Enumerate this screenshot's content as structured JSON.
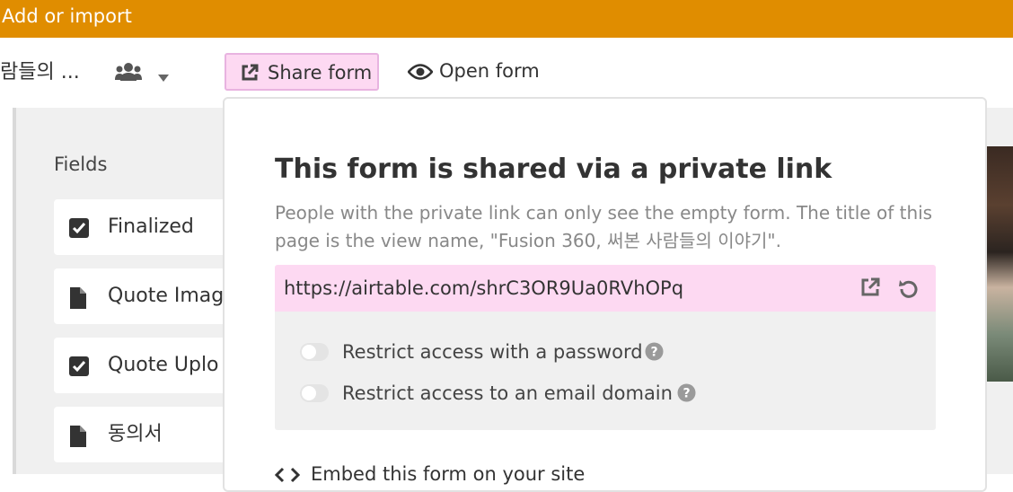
{
  "topbar": {
    "label": "Add or import"
  },
  "toolbar": {
    "view_name": "람들의 ...",
    "share_label": "Share form",
    "open_label": "Open form"
  },
  "fields_panel": {
    "heading": "Fields",
    "items": [
      {
        "label": "Finalized",
        "icon": "checkbox-icon"
      },
      {
        "label": "Quote Imag",
        "icon": "file-icon"
      },
      {
        "label": "Quote Uplo",
        "icon": "checkbox-icon"
      },
      {
        "label": "동의서",
        "icon": "file-icon"
      }
    ]
  },
  "share_popover": {
    "title": "This form is shared via a private link",
    "description": "People with the private link can only see the empty form. The title of this page is the view name, \"Fusion 360, 써본 사람들의 이야기\".",
    "link": "https://airtable.com/shrC3OR9Ua0RVhOPq",
    "options": [
      {
        "label": "Restrict access with a password",
        "enabled": false
      },
      {
        "label": "Restrict access to an email domain",
        "enabled": false
      }
    ],
    "embed_label": "Embed this form on your site"
  },
  "colors": {
    "accent_orange": "#e08d00",
    "share_highlight": "#fdd9f2",
    "share_border": "#e8b3e0",
    "panel_gray": "#f0f0f0"
  }
}
